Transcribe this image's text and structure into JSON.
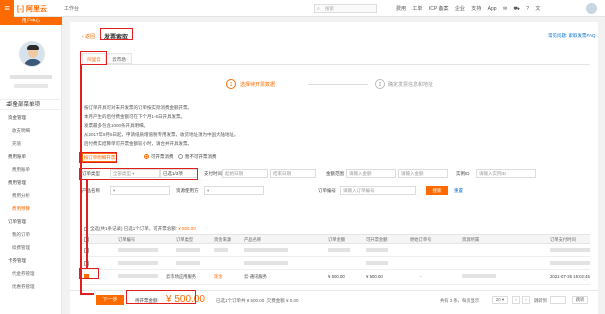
{
  "topbar": {
    "menu_icon": "menu-icon",
    "logo": "[-] 阿里云",
    "workbench": "工作台",
    "search_placeholder": "搜索",
    "nav": [
      "费用",
      "工单",
      "ICP 备案",
      "企业",
      "支持",
      "App"
    ]
  },
  "sidebar": {
    "user_tag": "用户中心",
    "all_menu": "全部菜单项",
    "items": [
      {
        "label": "首页",
        "level": 1
      },
      {
        "label": "资金管理",
        "level": 1
      },
      {
        "label": "收支明细",
        "level": 2
      },
      {
        "label": "充值",
        "level": 2
      },
      {
        "label": "费用账单",
        "level": 1
      },
      {
        "label": "费用账单",
        "level": 2
      },
      {
        "label": "费用管理",
        "level": 1
      },
      {
        "label": "费用分析",
        "level": 2
      },
      {
        "label": "费用预算",
        "level": 2
      },
      {
        "label": "订单管理",
        "level": 1
      },
      {
        "label": "我的订单",
        "level": 2
      },
      {
        "label": "续费管理",
        "level": 2
      },
      {
        "label": "卡券管理",
        "level": 1
      },
      {
        "label": "代金券管理",
        "level": 2
      },
      {
        "label": "优惠券管理",
        "level": 2
      }
    ]
  },
  "header": {
    "back": "‹ 返回",
    "title": "发票索取",
    "faq": "常见问题: 索取发票FAQ"
  },
  "tabs": [
    "阿里云",
    "云市场"
  ],
  "steps": [
    {
      "num": "1",
      "label": "选择待开票数据"
    },
    {
      "num": "2",
      "label": "确定发票信息和地址"
    }
  ],
  "notices": [
    "按订单开具可对未开发票的订单按实际消费金额开票。",
    "本月产生的后付费金额可在下个月1-5日开具发票。",
    "发票最多包含1000条开具明细。",
    "从2017年9月5日起，申请纸质增值税专用发票，收货地址须为中国大陆地址。",
    "后付费实结算单可开票金额较小时，请合并开具发票。"
  ],
  "filters": {
    "mode_button": "按订单明细开票",
    "radio_consumed": "可开票消费",
    "radio_not_consumed": "暂不可开票消费",
    "type_label": "订单类型",
    "type_value": "全部类型",
    "selected_count": "已选1/3项",
    "pay_time_label": "支付时间",
    "start_placeholder": "起始日期",
    "end_placeholder": "结束日期",
    "amount_label": "金额范围",
    "amount_placeholder": "请输入金额",
    "instance_label": "实例ID",
    "instance_placeholder": "请输入实例ID",
    "product_label": "产品名称",
    "resource_label": "资源使用方",
    "order_label": "订单编号",
    "order_placeholder": "请输入订单编号",
    "search_button": "搜索",
    "reset_link": "重置"
  },
  "summary": {
    "text": "全选(共1条记录) 已选1个订单，可开票总额:",
    "amount": "¥ 500.00"
  },
  "table": {
    "headers": [
      "订单编号",
      "订单类型",
      "资金来源",
      "产品名称",
      "订单金额",
      "可开票金额",
      "原始订单号",
      "资源所属",
      "订单支付时间"
    ],
    "row": {
      "order_type": "云市场应用服务",
      "fund_source": "现金",
      "product": "云·通讯服务",
      "order_amount": "¥ 500.00",
      "invoice_amount": "¥ 500.00",
      "original": "-",
      "pay_time": "2021-07-26 15:02:45"
    }
  },
  "footer": {
    "next": "下一步",
    "selected_label": "待开票金额:",
    "amount": "¥ 500.00",
    "detail": "已选1个订单共 ¥ 500.00 ,欠费金额 ¥ 0.00",
    "total": "共有 3 条，每页显示",
    "page_size": "20 ▾",
    "pager_prev": "‹",
    "pager_next": "›",
    "goto": "跳转到",
    "goto_btn": "跳转"
  }
}
